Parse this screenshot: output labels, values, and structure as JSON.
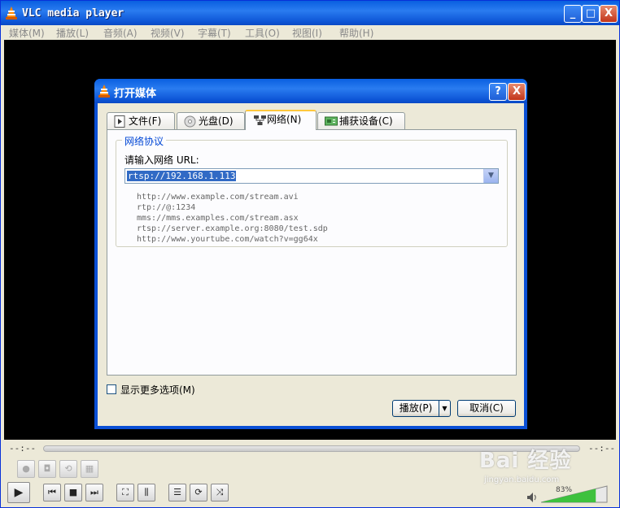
{
  "app": {
    "title": "VLC media player",
    "window_buttons": [
      "_",
      "□",
      "X"
    ]
  },
  "menu": [
    "媒体(M)",
    "播放(L)",
    "音频(A)",
    "视频(V)",
    "字幕(T)",
    "工具(O)",
    "视图(I)",
    "帮助(H)"
  ],
  "dialog": {
    "title": "打开媒体",
    "help_button": "?",
    "close_button": "X",
    "tabs": [
      "文件(F)",
      "光盘(D)",
      "网络(N)",
      "捕获设备(C)"
    ],
    "active_tab": 2,
    "group_title": "网络协议",
    "url_label": "请输入网络 URL:",
    "url_value": "rtsp://192.168.1.113",
    "examples": [
      "http://www.example.com/stream.avi",
      "rtp://@:1234",
      "mms://mms.examples.com/stream.asx",
      "rtsp://server.example.org:8080/test.sdp",
      "http://www.yourtube.com/watch?v=gg64x"
    ],
    "more_options_label": "显示更多选项(M)",
    "play_button": "播放(P)",
    "cancel_button": "取消(C)"
  },
  "player": {
    "time_elapsed": "--:--",
    "time_total": "--:--",
    "volume_label": "83%",
    "volume_level": 0.83
  },
  "watermark": {
    "brand": "Bai 经验",
    "url": "jingyan.baidu.com"
  },
  "colors": {
    "titlebar": "#0a5fe0",
    "selection": "#316ac5",
    "group_title": "#0046d5",
    "volume": "#3ec13e"
  }
}
